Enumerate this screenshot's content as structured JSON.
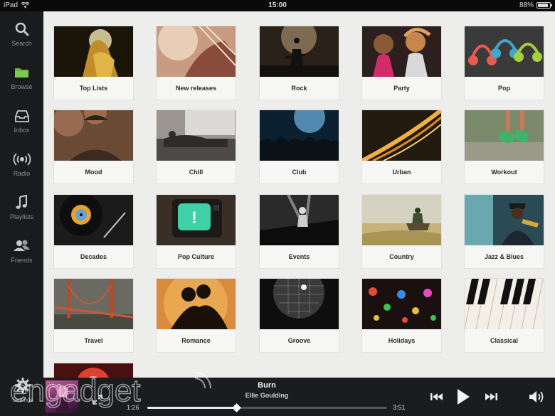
{
  "status": {
    "device": "iPad",
    "time": "15:00",
    "battery": "88%",
    "battery_level": 0.88
  },
  "sidebar": {
    "items": [
      {
        "label": "Search",
        "icon": "search-icon"
      },
      {
        "label": "Browse",
        "icon": "folder-icon",
        "active": true,
        "accent": "#6ab83a"
      },
      {
        "label": "Inbox",
        "icon": "inbox-icon"
      },
      {
        "label": "Radio",
        "icon": "radio-icon"
      },
      {
        "label": "Playlists",
        "icon": "music-note-icon"
      },
      {
        "label": "Friends",
        "icon": "friends-icon"
      }
    ],
    "settings": {
      "label": "Settings",
      "icon": "gear-icon"
    }
  },
  "categories": [
    "Top Lists",
    "New releases",
    "Rock",
    "Party",
    "Pop",
    "Mood",
    "Chill",
    "Club",
    "Urban",
    "Workout",
    "Decades",
    "Pop Culture",
    "Events",
    "Country",
    "Jazz & Blues",
    "Travel",
    "Romance",
    "Groove",
    "Holidays",
    "Classical"
  ],
  "player": {
    "title": "Burn",
    "artist": "Ellie Goulding",
    "elapsed": "1:26",
    "total": "3:51",
    "progress": 0.37
  },
  "watermark": "engadget"
}
